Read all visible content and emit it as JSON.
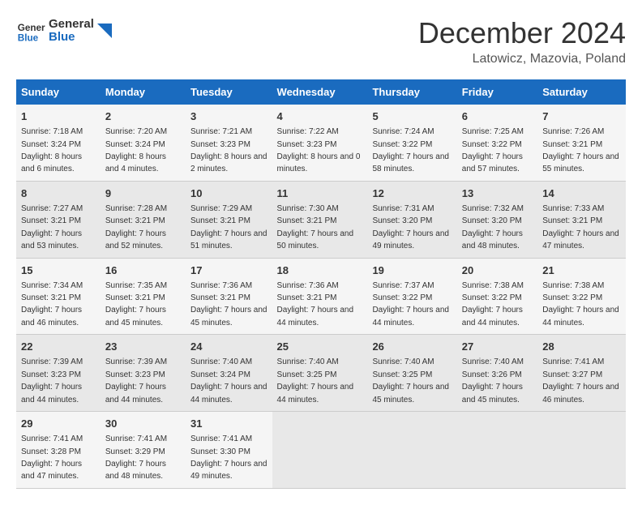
{
  "header": {
    "logo_general": "General",
    "logo_blue": "Blue",
    "title": "December 2024",
    "location": "Latowicz, Mazovia, Poland"
  },
  "days_of_week": [
    "Sunday",
    "Monday",
    "Tuesday",
    "Wednesday",
    "Thursday",
    "Friday",
    "Saturday"
  ],
  "weeks": [
    [
      {
        "day": "1",
        "sunrise": "7:18 AM",
        "sunset": "3:24 PM",
        "daylight": "8 hours and 6 minutes."
      },
      {
        "day": "2",
        "sunrise": "7:20 AM",
        "sunset": "3:24 PM",
        "daylight": "8 hours and 4 minutes."
      },
      {
        "day": "3",
        "sunrise": "7:21 AM",
        "sunset": "3:23 PM",
        "daylight": "8 hours and 2 minutes."
      },
      {
        "day": "4",
        "sunrise": "7:22 AM",
        "sunset": "3:23 PM",
        "daylight": "8 hours and 0 minutes."
      },
      {
        "day": "5",
        "sunrise": "7:24 AM",
        "sunset": "3:22 PM",
        "daylight": "7 hours and 58 minutes."
      },
      {
        "day": "6",
        "sunrise": "7:25 AM",
        "sunset": "3:22 PM",
        "daylight": "7 hours and 57 minutes."
      },
      {
        "day": "7",
        "sunrise": "7:26 AM",
        "sunset": "3:21 PM",
        "daylight": "7 hours and 55 minutes."
      }
    ],
    [
      {
        "day": "8",
        "sunrise": "7:27 AM",
        "sunset": "3:21 PM",
        "daylight": "7 hours and 53 minutes."
      },
      {
        "day": "9",
        "sunrise": "7:28 AM",
        "sunset": "3:21 PM",
        "daylight": "7 hours and 52 minutes."
      },
      {
        "day": "10",
        "sunrise": "7:29 AM",
        "sunset": "3:21 PM",
        "daylight": "7 hours and 51 minutes."
      },
      {
        "day": "11",
        "sunrise": "7:30 AM",
        "sunset": "3:21 PM",
        "daylight": "7 hours and 50 minutes."
      },
      {
        "day": "12",
        "sunrise": "7:31 AM",
        "sunset": "3:20 PM",
        "daylight": "7 hours and 49 minutes."
      },
      {
        "day": "13",
        "sunrise": "7:32 AM",
        "sunset": "3:20 PM",
        "daylight": "7 hours and 48 minutes."
      },
      {
        "day": "14",
        "sunrise": "7:33 AM",
        "sunset": "3:21 PM",
        "daylight": "7 hours and 47 minutes."
      }
    ],
    [
      {
        "day": "15",
        "sunrise": "7:34 AM",
        "sunset": "3:21 PM",
        "daylight": "7 hours and 46 minutes."
      },
      {
        "day": "16",
        "sunrise": "7:35 AM",
        "sunset": "3:21 PM",
        "daylight": "7 hours and 45 minutes."
      },
      {
        "day": "17",
        "sunrise": "7:36 AM",
        "sunset": "3:21 PM",
        "daylight": "7 hours and 45 minutes."
      },
      {
        "day": "18",
        "sunrise": "7:36 AM",
        "sunset": "3:21 PM",
        "daylight": "7 hours and 44 minutes."
      },
      {
        "day": "19",
        "sunrise": "7:37 AM",
        "sunset": "3:22 PM",
        "daylight": "7 hours and 44 minutes."
      },
      {
        "day": "20",
        "sunrise": "7:38 AM",
        "sunset": "3:22 PM",
        "daylight": "7 hours and 44 minutes."
      },
      {
        "day": "21",
        "sunrise": "7:38 AM",
        "sunset": "3:22 PM",
        "daylight": "7 hours and 44 minutes."
      }
    ],
    [
      {
        "day": "22",
        "sunrise": "7:39 AM",
        "sunset": "3:23 PM",
        "daylight": "7 hours and 44 minutes."
      },
      {
        "day": "23",
        "sunrise": "7:39 AM",
        "sunset": "3:23 PM",
        "daylight": "7 hours and 44 minutes."
      },
      {
        "day": "24",
        "sunrise": "7:40 AM",
        "sunset": "3:24 PM",
        "daylight": "7 hours and 44 minutes."
      },
      {
        "day": "25",
        "sunrise": "7:40 AM",
        "sunset": "3:25 PM",
        "daylight": "7 hours and 44 minutes."
      },
      {
        "day": "26",
        "sunrise": "7:40 AM",
        "sunset": "3:25 PM",
        "daylight": "7 hours and 45 minutes."
      },
      {
        "day": "27",
        "sunrise": "7:40 AM",
        "sunset": "3:26 PM",
        "daylight": "7 hours and 45 minutes."
      },
      {
        "day": "28",
        "sunrise": "7:41 AM",
        "sunset": "3:27 PM",
        "daylight": "7 hours and 46 minutes."
      }
    ],
    [
      {
        "day": "29",
        "sunrise": "7:41 AM",
        "sunset": "3:28 PM",
        "daylight": "7 hours and 47 minutes."
      },
      {
        "day": "30",
        "sunrise": "7:41 AM",
        "sunset": "3:29 PM",
        "daylight": "7 hours and 48 minutes."
      },
      {
        "day": "31",
        "sunrise": "7:41 AM",
        "sunset": "3:30 PM",
        "daylight": "7 hours and 49 minutes."
      },
      null,
      null,
      null,
      null
    ]
  ]
}
